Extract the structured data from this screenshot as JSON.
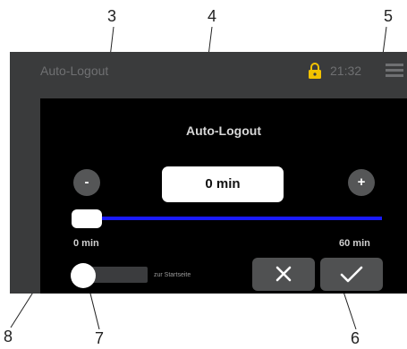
{
  "header": {
    "title": "Auto-Logout",
    "time": "21:32",
    "lock_icon": "padlock-icon",
    "menu_icon": "hamburger-menu-icon"
  },
  "dialog": {
    "title": "Auto-Logout",
    "minus_label": "-",
    "plus_label": "+",
    "value": "0 min",
    "slider": {
      "min_label": "0 min",
      "max_label": "60 min",
      "value_fraction": 0.0
    },
    "toggle": {
      "label": "zur Startseite",
      "on": false
    },
    "cancel_icon": "close-icon",
    "confirm_icon": "checkmark-icon"
  },
  "callouts": [
    "3",
    "4",
    "5",
    "6",
    "7",
    "8"
  ],
  "colors": {
    "frame": "#3a3b3c",
    "dialog_bg": "#000000",
    "slider_track": "#1a1aff",
    "lock": "#f2c200",
    "button": "#555657"
  }
}
